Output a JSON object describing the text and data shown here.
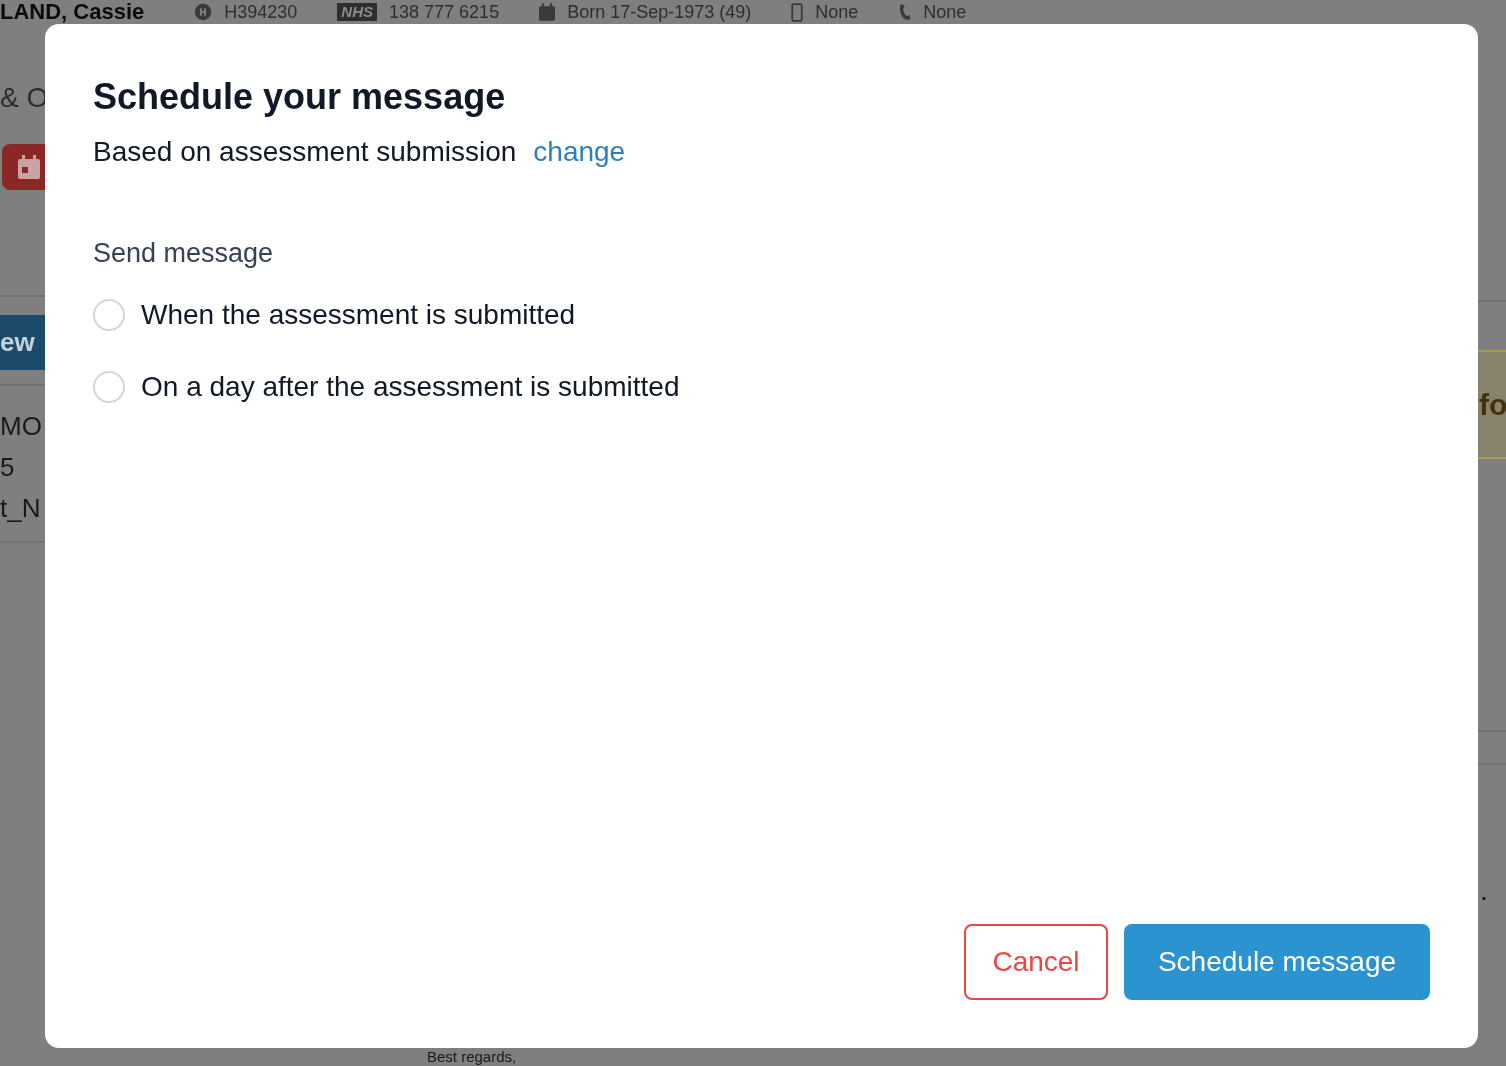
{
  "background": {
    "header": {
      "patient_name": "LAND, Cassie",
      "hospital_number": "H394230",
      "nhs_badge": "NHS",
      "nhs_number": "138 777 6215",
      "born": "Born 17-Sep-1973 (49)",
      "mobile": "None",
      "phone": "None"
    },
    "left": {
      "heading": "& O",
      "new_button": "ew",
      "lines": [
        "MO",
        "5",
        "t_N"
      ]
    },
    "right": {
      "notice": "fo",
      "mark": "."
    },
    "footer_text": "Best regards,"
  },
  "dialog": {
    "title": "Schedule your message",
    "subtitle": "Based on assessment submission",
    "change_link": "change",
    "section_label": "Send message",
    "options": [
      {
        "label": "When the assessment is submitted",
        "selected": false
      },
      {
        "label": "On a day after the assessment is submitted",
        "selected": false
      }
    ],
    "cancel_button": "Cancel",
    "confirm_button": "Schedule message"
  }
}
